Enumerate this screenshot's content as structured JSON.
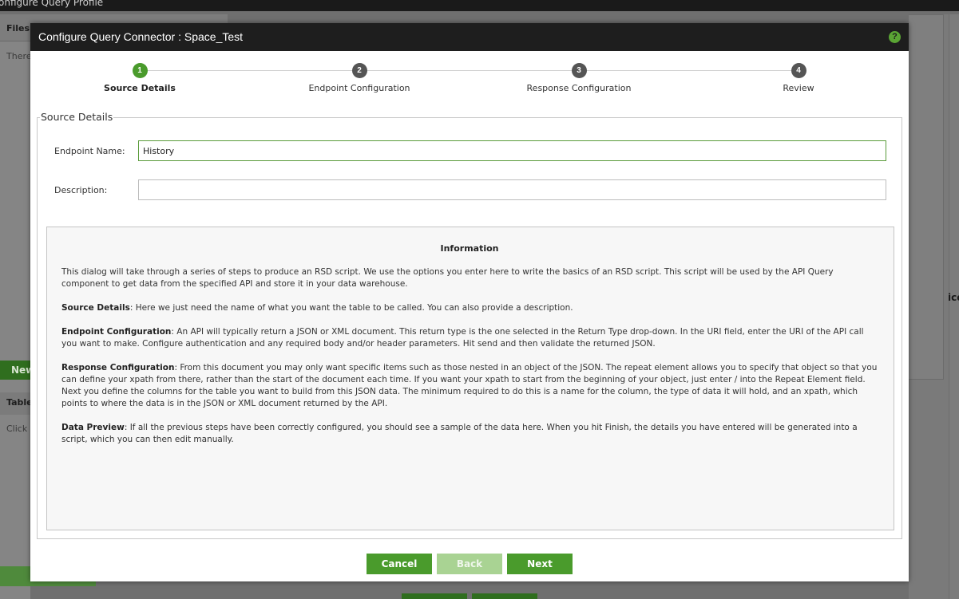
{
  "background": {
    "title_fragment": "onfigure Query Profile",
    "files_tab": "Files",
    "there_text": "There",
    "new_button": "New",
    "table_tab": "Table",
    "click_text": "Click t",
    "right_fragment": "ice"
  },
  "dialog": {
    "title": "Configure Query Connector : Space_Test",
    "help_icon": "?",
    "steps": [
      {
        "number": "1",
        "label": "Source Details",
        "active": true
      },
      {
        "number": "2",
        "label": "Endpoint Configuration",
        "active": false
      },
      {
        "number": "3",
        "label": "Response Configuration",
        "active": false
      },
      {
        "number": "4",
        "label": "Review",
        "active": false
      }
    ],
    "section_legend": "Source Details",
    "endpoint_name": {
      "label": "Endpoint Name:",
      "value": "History"
    },
    "description": {
      "label": "Description:",
      "value": ""
    },
    "info": {
      "title": "Information",
      "intro": "This dialog will take through a series of steps to produce an RSD script. We use the options you enter here to write the basics of an RSD script. This script will be used by the API Query component to get data from the specified API and store it in your data warehouse.",
      "paragraphs": [
        {
          "term": "Source Details",
          "text": ": Here we just need the name of what you want the table to be called. You can also provide a description."
        },
        {
          "term": "Endpoint Configuration",
          "text": ": An API will typically return a JSON or XML document. This return type is the one selected in the Return Type drop-down. In the URI field, enter the URI of the API call you want to make. Configure authentication and any required body and/or header parameters. Hit send and then validate the returned JSON."
        },
        {
          "term": "Response Configuration",
          "text": ": From this document you may only want specific items such as those nested in an object of the JSON. The repeat element allows you to specify that object so that you can define your xpath from there, rather than the start of the document each time. If you want your xpath to start from the beginning of your object, just enter / into the Repeat Element field. Next you define the columns for the table you want to build from this JSON data. The minimum required to do this is a name for the column, the type of data it will hold, and an xpath, which points to where the data is in the JSON or XML document returned by the API."
        },
        {
          "term": "Data Preview",
          "text": ": If all the previous steps have been correctly configured, you should see a sample of the data here. When you hit Finish, the details you have entered will be generated into a script, which you can then edit manually."
        }
      ]
    },
    "buttons": {
      "cancel": "Cancel",
      "back": "Back",
      "next": "Next"
    },
    "colors": {
      "accent": "#4a9b2c",
      "disabled": "#a9d393",
      "titlebar": "#1e1e1e"
    }
  }
}
